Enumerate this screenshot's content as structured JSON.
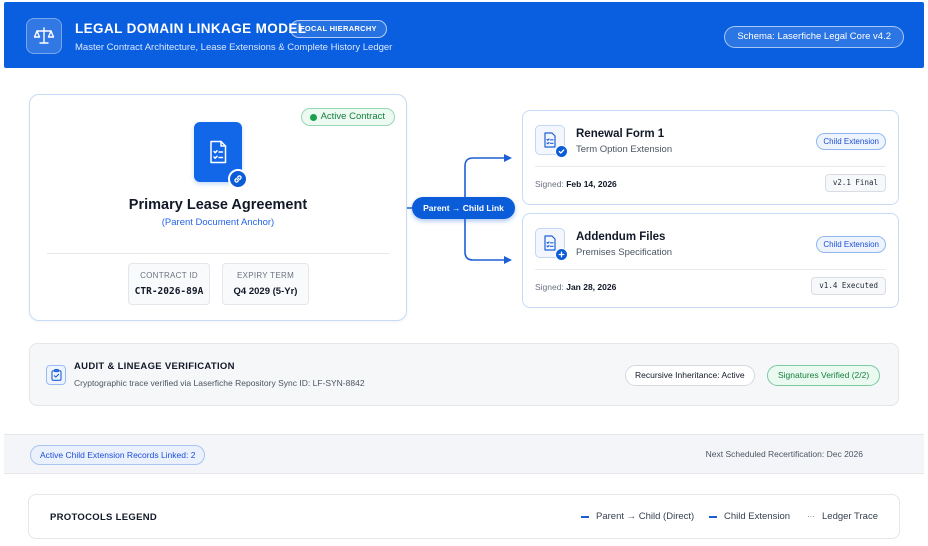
{
  "header": {
    "title": "LEGAL DOMAIN LINKAGE MODEL",
    "badge": "FOCAL HIERARCHY",
    "subtitle": "Master Contract Architecture, Lease Extensions & Complete History Ledger",
    "schema": "Schema: Laserfiche Legal Core v4.2",
    "logo_icon": "scales-icon"
  },
  "primary": {
    "status": "Active Contract",
    "title": "Primary Lease Agreement",
    "subtitle": "(Parent Document Anchor)",
    "contract_id_label": "CONTRACT ID",
    "contract_id": "CTR-2026-89A",
    "expiry_label": "EXPIRY TERM",
    "expiry": "Q4 2029 (5-Yr)",
    "icon": "document-icon",
    "badge_icon": "link-icon"
  },
  "link": {
    "label": "Parent → Child Link"
  },
  "children": [
    {
      "title": "Renewal Form 1",
      "subtitle": "Term Option Extension",
      "badge": "Child Extension",
      "signed_label": "Signed:",
      "signed_date": "Feb 14, 2026",
      "version": "v2.1 Final",
      "status_icon": "check-icon"
    },
    {
      "title": "Addendum Files",
      "subtitle": "Premises Specification",
      "badge": "Child Extension",
      "signed_label": "Signed:",
      "signed_date": "Jan 28, 2026",
      "version": "v1.4 Executed",
      "status_icon": "plus-icon"
    }
  ],
  "audit": {
    "title": "AUDIT & LINEAGE VERIFICATION",
    "subtitle": "Cryptographic trace verified via Laserfiche Repository Sync ID: LF-SYN-8842",
    "recursive": "Recursive Inheritance: Active",
    "signatures": "Signatures Verified (2/2)"
  },
  "footer": {
    "linked": "Active Child Extension Records Linked: 2",
    "recert": "Next Scheduled Recertification: Dec 2026"
  },
  "legend": {
    "title": "PROTOCOLS LEGEND",
    "items": [
      "Parent → Child (Direct)",
      "Child Extension",
      "Ledger Trace"
    ]
  },
  "colors": {
    "brand": "#0a5fe0",
    "accent": "#0b5cd8",
    "success": "#15803d"
  }
}
